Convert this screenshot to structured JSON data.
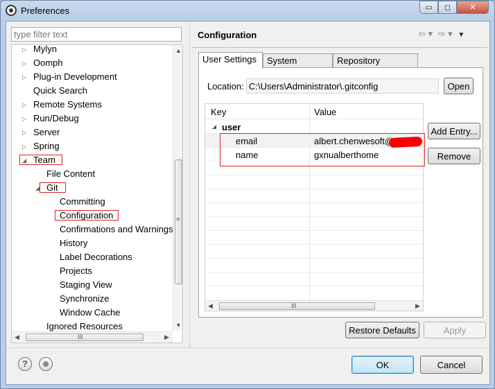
{
  "window": {
    "title": "Preferences"
  },
  "caption_buttons": {
    "minimize": "▭",
    "maximize": "◻",
    "close": "✕"
  },
  "filter": {
    "placeholder": "type filter text"
  },
  "tree": {
    "items": [
      {
        "label": "Mylyn",
        "expander": "▷"
      },
      {
        "label": "Oomph",
        "expander": "▷"
      },
      {
        "label": "Plug-in Development",
        "expander": "▷"
      },
      {
        "label": "Quick Search",
        "expander": ""
      },
      {
        "label": "Remote Systems",
        "expander": "▷"
      },
      {
        "label": "Run/Debug",
        "expander": "▷"
      },
      {
        "label": "Server",
        "expander": "▷"
      },
      {
        "label": "Spring",
        "expander": "▷"
      },
      {
        "label": "Team",
        "expander": "◢"
      },
      {
        "label": "File Content",
        "expander": ""
      },
      {
        "label": "Git",
        "expander": "◢"
      },
      {
        "label": "Committing",
        "expander": ""
      },
      {
        "label": "Configuration",
        "expander": ""
      },
      {
        "label": "Confirmations and Warnings",
        "expander": ""
      },
      {
        "label": "History",
        "expander": ""
      },
      {
        "label": "Label Decorations",
        "expander": ""
      },
      {
        "label": "Projects",
        "expander": ""
      },
      {
        "label": "Staging View",
        "expander": ""
      },
      {
        "label": "Synchronize",
        "expander": ""
      },
      {
        "label": "Window Cache",
        "expander": ""
      },
      {
        "label": "Ignored Resources",
        "expander": ""
      }
    ],
    "scroll_grip": "≡",
    "hscroll_grip": "III",
    "scroll_up": "▲",
    "scroll_down": "▼",
    "scroll_left": "◀",
    "scroll_right": "▶"
  },
  "page": {
    "title": "Configuration",
    "nav_back": "⇦ ▾",
    "nav_forward": "⇨ ▾",
    "menu": "▼"
  },
  "tabs": [
    "User Settings",
    "System Settings",
    "Repository Settings"
  ],
  "location": {
    "label": "Location:",
    "value": "C:\\Users\\Administrator\\.gitconfig",
    "open_button": "Open"
  },
  "table": {
    "headers": {
      "key": "Key",
      "value": "Value"
    },
    "group": {
      "expander": "◢",
      "label": "user"
    },
    "rows": [
      {
        "key": "email",
        "value": "albert.chenwesoft@"
      },
      {
        "key": "name",
        "value": "gxnualberthome"
      }
    ],
    "hscroll_grip": "III"
  },
  "side_buttons": {
    "add_entry": "Add Entry...",
    "remove": "Remove"
  },
  "page_buttons": {
    "restore_defaults": "Restore Defaults",
    "apply": "Apply"
  },
  "dialog_buttons": {
    "ok": "OK",
    "cancel": "Cancel"
  },
  "help": {
    "symbol": "?"
  }
}
